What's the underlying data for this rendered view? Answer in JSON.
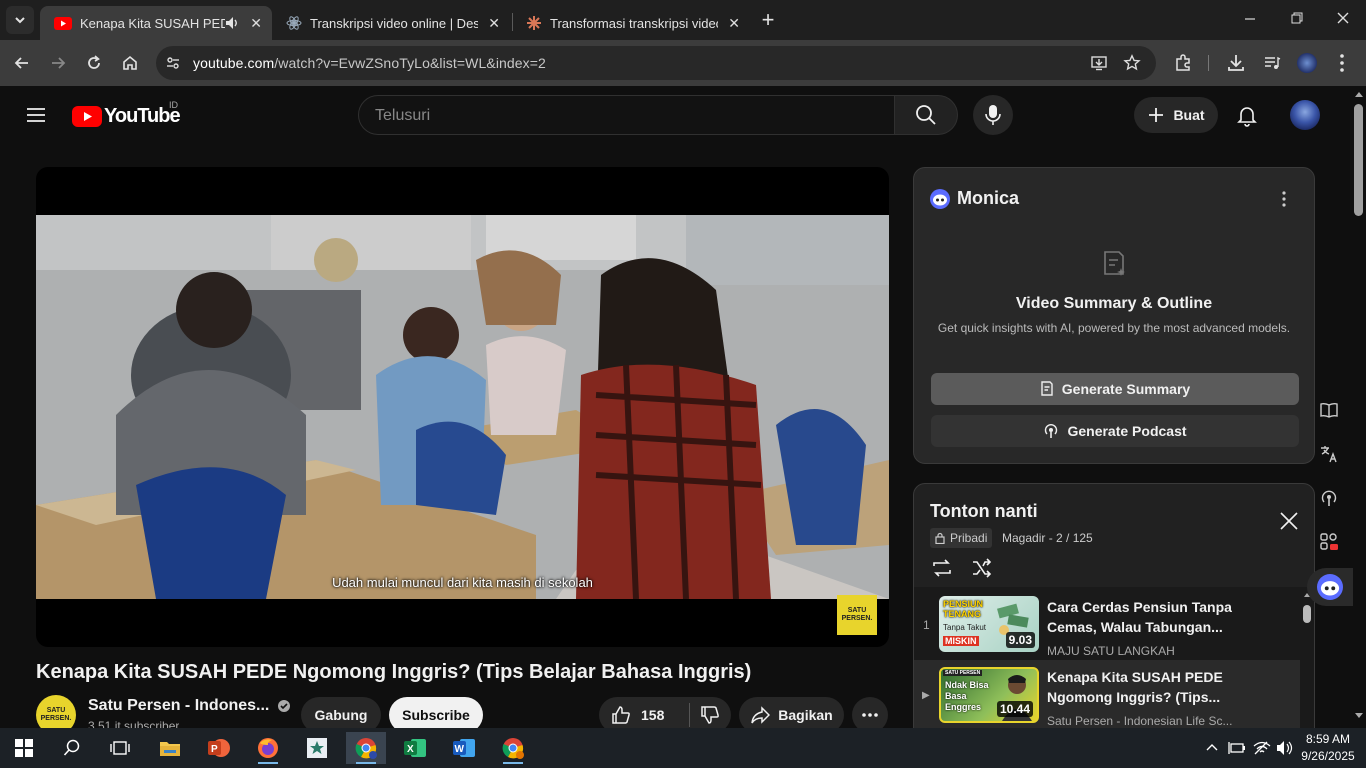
{
  "browser": {
    "tabs": [
      {
        "label": "Kenapa Kita SUSAH PEDE N",
        "active": true
      },
      {
        "label": "Transkripsi video online | Desgn",
        "active": false
      },
      {
        "label": "Transformasi transkripsi video n",
        "active": false
      }
    ],
    "new_tab_label": "+",
    "url_host": "youtube.com",
    "url_path": "/watch?v=EvwZSnoTyLo&list=WL&index=2"
  },
  "youtube": {
    "logo_text": "YouTube",
    "region_badge": "ID",
    "search_placeholder": "Telusuri",
    "create_label": "Buat"
  },
  "video": {
    "subtitle": "Udah mulai muncul dari kita masih di sekolah",
    "watermark": "SATU PERSEN.",
    "title": "Kenapa Kita SUSAH PEDE Ngomong Inggris? (Tips Belajar Bahasa Inggris)",
    "channel_name": "Satu Persen - Indones...",
    "channel_avatar_text": "SATU PERSEN.",
    "subscribers": "3,51 jt subscriber",
    "join_label": "Gabung",
    "subscribe_label": "Subscribe",
    "likes": "158",
    "share_label": "Bagikan"
  },
  "monica": {
    "brand": "Monica",
    "heading": "Video Summary & Outline",
    "description": "Get quick insights with AI, powered by the most advanced models.",
    "summary_button": "Generate Summary",
    "podcast_button": "Generate Podcast"
  },
  "playlist": {
    "title": "Tonton nanti",
    "privacy": "Pribadi",
    "owner_count": "Magadir - 2 / 125",
    "items": [
      {
        "index": "1",
        "title": "Cara Cerdas Pensiun Tanpa Cemas, Walau Tabungan...",
        "channel": "MAJU SATU LANGKAH",
        "duration": "9.03",
        "thumb_top": "PENSIUN TENANG",
        "thumb_mid": "Tanpa Takut",
        "thumb_bottom": "MISKIN"
      },
      {
        "index": "▶",
        "title": "Kenapa Kita SUSAH PEDE Ngomong Inggris? (Tips...",
        "channel": "Satu Persen - Indonesian Life Sc...",
        "duration": "10.44",
        "thumb_top": "SATU PERSEN",
        "thumb_mid": "Ndak Bisa Basa Enggres",
        "thumb_bottom": ""
      }
    ]
  },
  "taskbar": {
    "time": "8:59 AM",
    "date": "9/26/2025"
  },
  "colors": {
    "yt_red": "#ff0000",
    "subscribe_bg": "#f1f1f1",
    "monica_primary": "#5b5b5b",
    "brand_yellow": "#e8d42c"
  }
}
